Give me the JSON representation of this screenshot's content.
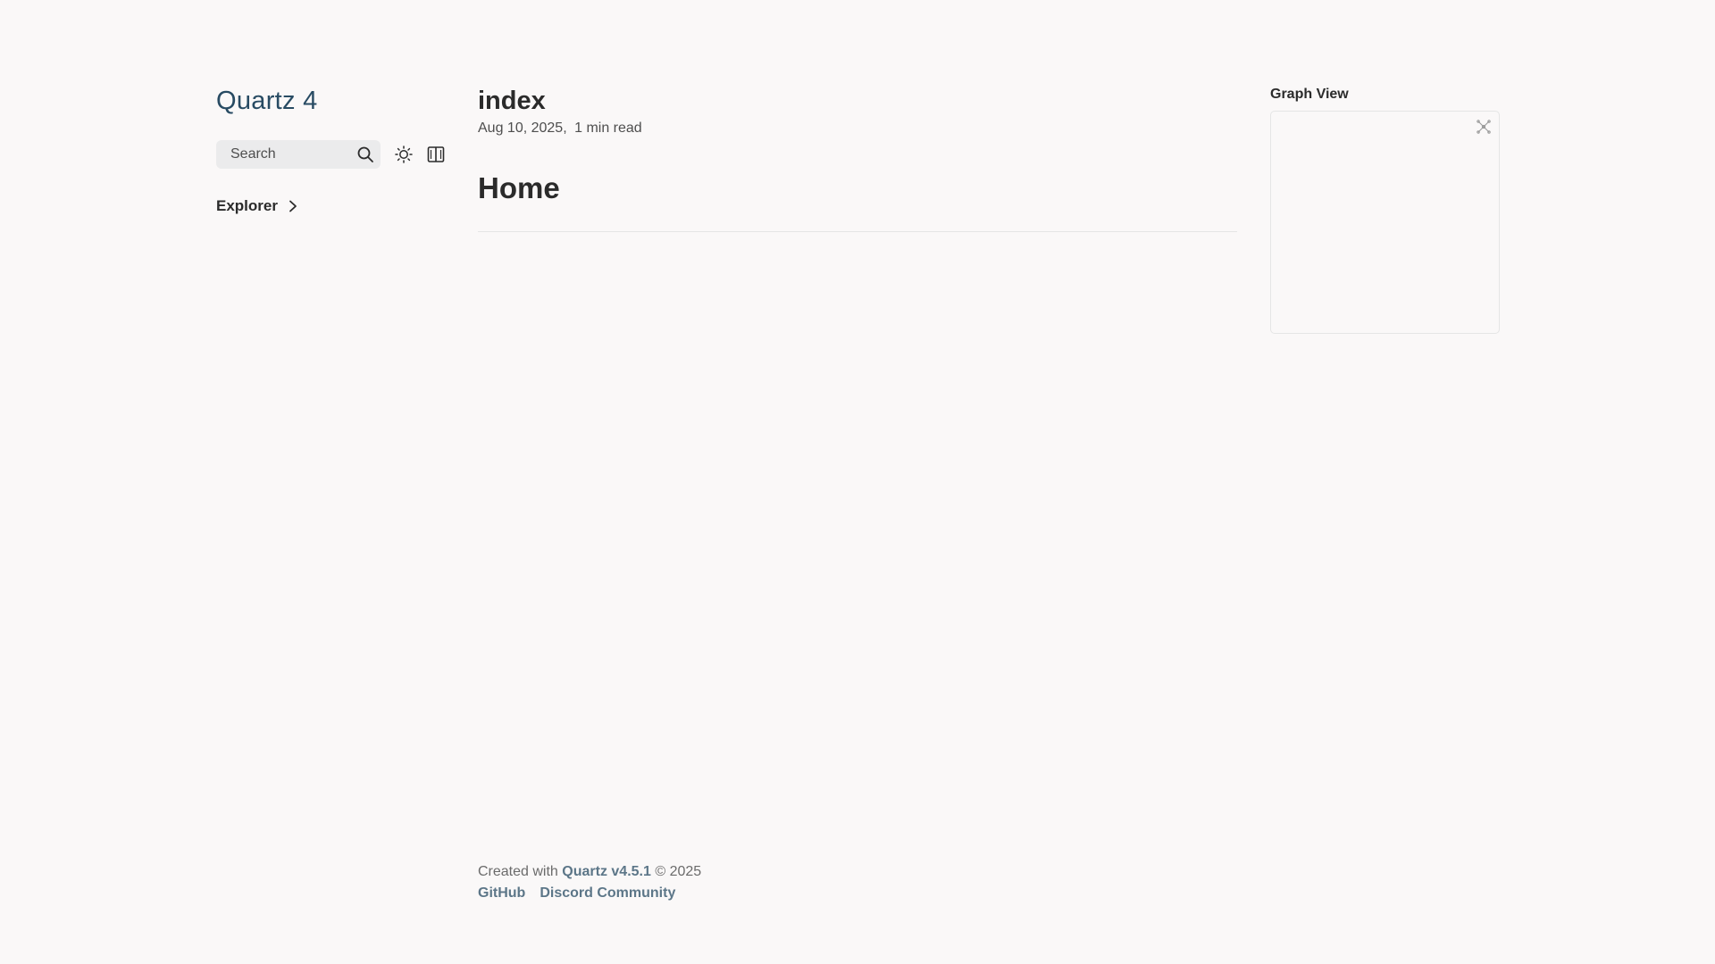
{
  "sidebar": {
    "site_title": "Quartz 4",
    "search_placeholder": "Search",
    "explorer_label": "Explorer"
  },
  "article": {
    "title": "index",
    "date": "Aug 10, 2025",
    "read_time": "1 min read",
    "heading": "Home"
  },
  "graph": {
    "title": "Graph View"
  },
  "footer": {
    "created_prefix": "Created with",
    "brand_link": "Quartz v4.5.1",
    "copyright": "© 2025",
    "links": [
      "GitHub",
      "Discord Community"
    ]
  },
  "colors": {
    "background": "#faf8f8",
    "accent": "#284b63",
    "text": "#2b2b2b"
  },
  "icons": [
    "search-icon",
    "sun-icon",
    "book-icon",
    "chevron-right-icon",
    "global-graph-icon"
  ]
}
